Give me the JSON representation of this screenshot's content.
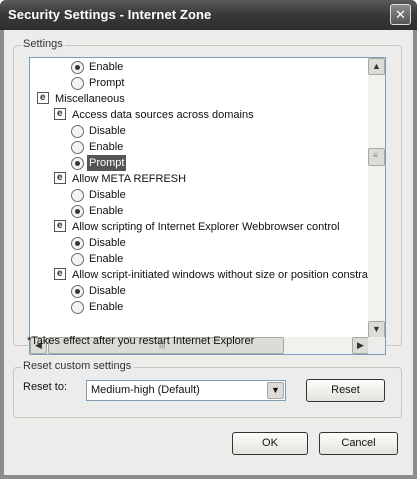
{
  "window": {
    "title": "Security Settings - Internet Zone",
    "close_glyph": "✕"
  },
  "settings_group": {
    "legend": "Settings"
  },
  "tree_rows": [
    {
      "type": "radio",
      "indent": 2,
      "label": "Enable",
      "checked": true
    },
    {
      "type": "radio",
      "indent": 2,
      "label": "Prompt",
      "checked": false
    },
    {
      "type": "node",
      "indent": 0,
      "label": "Miscellaneous"
    },
    {
      "type": "node",
      "indent": 1,
      "label": "Access data sources across domains"
    },
    {
      "type": "radio",
      "indent": 2,
      "label": "Disable",
      "checked": false
    },
    {
      "type": "radio",
      "indent": 2,
      "label": "Enable",
      "checked": false
    },
    {
      "type": "radio",
      "indent": 2,
      "label": "Prompt",
      "checked": true,
      "highlighted": true
    },
    {
      "type": "node",
      "indent": 1,
      "label": "Allow META REFRESH"
    },
    {
      "type": "radio",
      "indent": 2,
      "label": "Disable",
      "checked": false
    },
    {
      "type": "radio",
      "indent": 2,
      "label": "Enable",
      "checked": true
    },
    {
      "type": "node",
      "indent": 1,
      "label": "Allow scripting of Internet Explorer Webbrowser control"
    },
    {
      "type": "radio",
      "indent": 2,
      "label": "Disable",
      "checked": true
    },
    {
      "type": "radio",
      "indent": 2,
      "label": "Enable",
      "checked": false
    },
    {
      "type": "node",
      "indent": 1,
      "label": "Allow script-initiated windows without size or position constrai"
    },
    {
      "type": "radio",
      "indent": 2,
      "label": "Disable",
      "checked": true
    },
    {
      "type": "radio",
      "indent": 2,
      "label": "Enable",
      "checked": false
    }
  ],
  "scroll": {
    "up": "▲",
    "down": "▼",
    "left": "◀",
    "right": "▶",
    "grip_v": "≡",
    "grip_h": "|||"
  },
  "note": "*Takes effect after you restart Internet Explorer",
  "reset_group": {
    "legend": "Reset custom settings",
    "reset_to_label": "Reset to:",
    "selected_level": "Medium-high (Default)",
    "dropdown_glyph": "▼",
    "reset_button": "Reset"
  },
  "buttons": {
    "ok": "OK",
    "cancel": "Cancel"
  }
}
